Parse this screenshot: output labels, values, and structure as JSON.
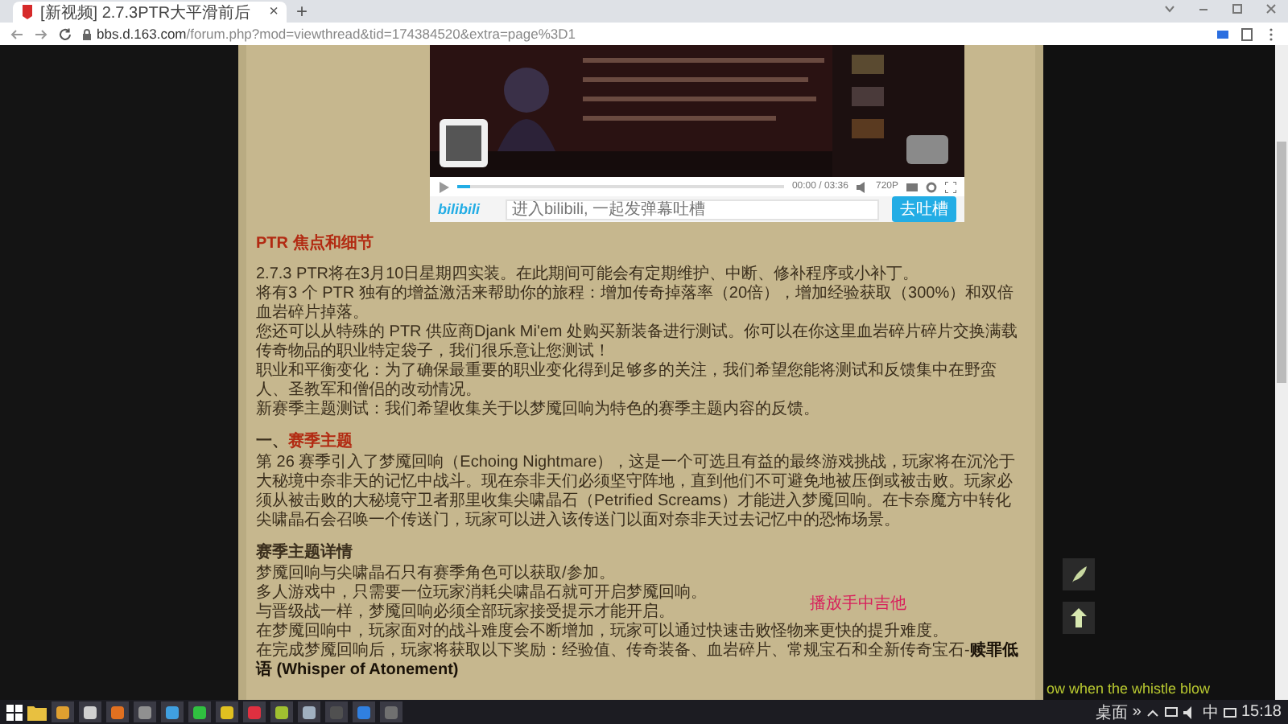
{
  "browser": {
    "tabs": [
      {
        "title": "[新视频] 2.7.3PTR大平滑前后",
        "selected": true
      }
    ],
    "close_tab": "×",
    "new_tab": "+",
    "url_domain": "bbs.d.163.com",
    "url_path": "/forum.php?mod=viewthread&tid=174384520&extra=page%3D1"
  },
  "video": {
    "progress": {
      "level": 0.04
    },
    "time": "00:00 / 03:36",
    "quality": "720P",
    "logo": "bilibili",
    "comment_placeholder": "进入bilibili, 一起发弹幕吐槽",
    "send_button": "去吐槽"
  },
  "article": {
    "blocks": [
      {
        "kind": "red-heading",
        "text": "PTR 焦点和细节"
      },
      {
        "kind": "line",
        "text": "2.7.3 PTR将在3月10日星期四实装。在此期间可能会有定期维护、中断、修补程序或小补丁。"
      },
      {
        "kind": "line",
        "text": "将有3 个 PTR 独有的增益激活来帮助你的旅程：增加传奇掉落率（20倍），增加经验获取（300%）和双倍血岩碎片掉落。"
      },
      {
        "kind": "line",
        "text": "您还可以从特殊的 PTR 供应商Djank Mi'em 处购买新装备进行测试。你可以在你这里血岩碎片碎片交换满载传奇物品的职业特定袋子，我们很乐意让您测试！"
      },
      {
        "kind": "line",
        "text": "职业和平衡变化：为了确保最重要的职业变化得到足够多的关注，我们希望您能将测试和反馈集中在野蛮人、圣教军和僧侣的改动情况。"
      },
      {
        "kind": "line",
        "text": "新赛季主题测试：我们希望收集关于以梦魇回响为特色的赛季主题内容的反馈。"
      },
      {
        "kind": "numbered-heading",
        "number": "一、",
        "text": "赛季主题"
      },
      {
        "kind": "line",
        "text": "第 26 赛季引入了梦魇回响（Echoing Nightmare），这是一个可选且有益的最终游戏挑战，玩家将在沉沦于大秘境中奈非天的记忆中战斗。现在奈非天们必须坚守阵地，直到他们不可避免地被压倒或被击败。玩家必须从被击败的大秘境守卫者那里收集尖啸晶石（Petrified Screams）才能进入梦魇回响。在卡奈魔方中转化尖啸晶石会召唤一个传送门，玩家可以进入该传送门以面对奈非天过去记忆中的恐怖场景。"
      },
      {
        "kind": "heading",
        "text": "赛季主题详情"
      },
      {
        "kind": "line",
        "text": "梦魇回响与尖啸晶石只有赛季角色可以获取/参加。"
      },
      {
        "kind": "line",
        "text": "多人游戏中，只需要一位玩家消耗尖啸晶石就可开启梦魇回响。"
      },
      {
        "kind": "line",
        "text": "与晋级战一样，梦魇回响必须全部玩家接受提示才能开启。"
      },
      {
        "kind": "line",
        "text": "在梦魇回响中，玩家面对的战斗难度会不断增加，玩家可以通过快速击败怪物来更快的提升难度。"
      },
      {
        "kind": "line",
        "text": "在完成梦魇回响后，玩家将获取以下奖励：经验值、传奇装备、血岩碎片、常规宝石和全新传奇宝石-**赎罪低语 (Whisper of Atonement)**"
      }
    ]
  },
  "overlays": {
    "danmaku": "播放手中吉他",
    "lyrics": "ow when the whistle blow"
  },
  "taskbar": {
    "apps": [
      {
        "color": "#e0a030"
      },
      {
        "color": "#d0d0d0"
      },
      {
        "color": "#e07020"
      },
      {
        "color": "#909090"
      },
      {
        "color": "#40a0e0"
      },
      {
        "color": "#30c040"
      },
      {
        "color": "#e0c020"
      },
      {
        "color": "#e03040"
      },
      {
        "color": "#a0c030"
      },
      {
        "color": "#a0b0c0"
      },
      {
        "color": "#505050"
      },
      {
        "color": "#3080e0"
      },
      {
        "color": "#707070"
      }
    ],
    "desktop": "桌面",
    "more": "»",
    "ime": "中",
    "clock": "15:18"
  }
}
